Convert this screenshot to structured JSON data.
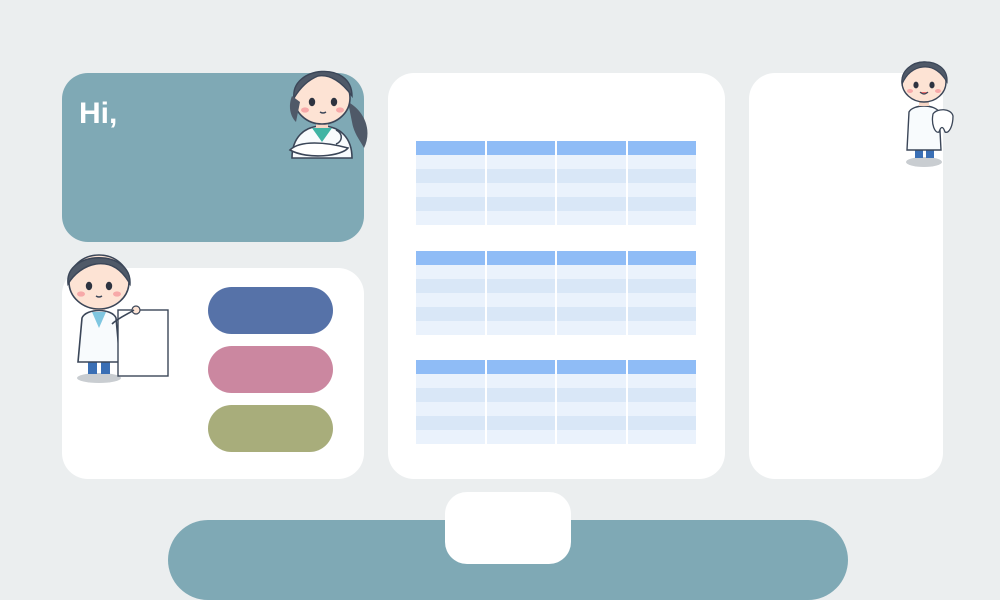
{
  "greeting": {
    "text": "Hi,"
  },
  "buttons": {
    "blue_color": "#5672a8",
    "pink_color": "#cb87a0",
    "olive_color": "#a8ad7b"
  },
  "tables": {
    "header_color": "#8fbcf6",
    "row_colors": [
      "#eaf2fc",
      "#d9e7f7"
    ],
    "columns": 4,
    "rows_per_table": 5,
    "count": 3
  },
  "illustrations": {
    "top_left": "doctor-girl-arms-crossed",
    "middle_left": "doctor-boy-holding-board",
    "top_right": "dentist-boy-holding-tooth"
  },
  "colors": {
    "background": "#ebeeef",
    "teal": "#7fa9b5",
    "card": "#ffffff"
  }
}
